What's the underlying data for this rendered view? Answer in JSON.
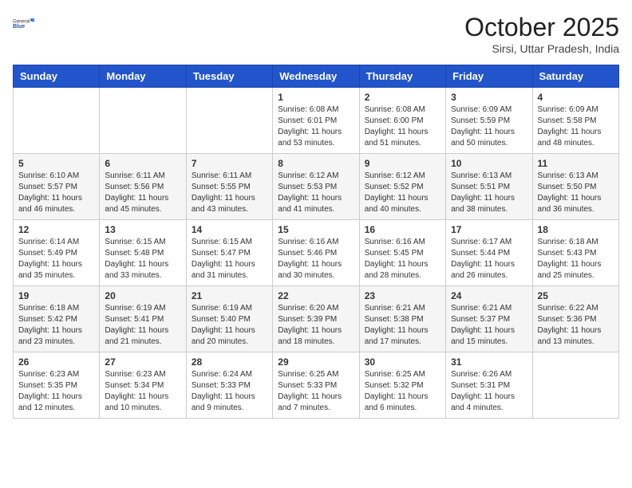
{
  "header": {
    "logo_general": "General",
    "logo_blue": "Blue",
    "month_title": "October 2025",
    "subtitle": "Sirsi, Uttar Pradesh, India"
  },
  "weekdays": [
    "Sunday",
    "Monday",
    "Tuesday",
    "Wednesday",
    "Thursday",
    "Friday",
    "Saturday"
  ],
  "weeks": [
    [
      {
        "day": "",
        "sunrise": "",
        "sunset": "",
        "daylight": ""
      },
      {
        "day": "",
        "sunrise": "",
        "sunset": "",
        "daylight": ""
      },
      {
        "day": "",
        "sunrise": "",
        "sunset": "",
        "daylight": ""
      },
      {
        "day": "1",
        "sunrise": "Sunrise: 6:08 AM",
        "sunset": "Sunset: 6:01 PM",
        "daylight": "Daylight: 11 hours and 53 minutes."
      },
      {
        "day": "2",
        "sunrise": "Sunrise: 6:08 AM",
        "sunset": "Sunset: 6:00 PM",
        "daylight": "Daylight: 11 hours and 51 minutes."
      },
      {
        "day": "3",
        "sunrise": "Sunrise: 6:09 AM",
        "sunset": "Sunset: 5:59 PM",
        "daylight": "Daylight: 11 hours and 50 minutes."
      },
      {
        "day": "4",
        "sunrise": "Sunrise: 6:09 AM",
        "sunset": "Sunset: 5:58 PM",
        "daylight": "Daylight: 11 hours and 48 minutes."
      }
    ],
    [
      {
        "day": "5",
        "sunrise": "Sunrise: 6:10 AM",
        "sunset": "Sunset: 5:57 PM",
        "daylight": "Daylight: 11 hours and 46 minutes."
      },
      {
        "day": "6",
        "sunrise": "Sunrise: 6:11 AM",
        "sunset": "Sunset: 5:56 PM",
        "daylight": "Daylight: 11 hours and 45 minutes."
      },
      {
        "day": "7",
        "sunrise": "Sunrise: 6:11 AM",
        "sunset": "Sunset: 5:55 PM",
        "daylight": "Daylight: 11 hours and 43 minutes."
      },
      {
        "day": "8",
        "sunrise": "Sunrise: 6:12 AM",
        "sunset": "Sunset: 5:53 PM",
        "daylight": "Daylight: 11 hours and 41 minutes."
      },
      {
        "day": "9",
        "sunrise": "Sunrise: 6:12 AM",
        "sunset": "Sunset: 5:52 PM",
        "daylight": "Daylight: 11 hours and 40 minutes."
      },
      {
        "day": "10",
        "sunrise": "Sunrise: 6:13 AM",
        "sunset": "Sunset: 5:51 PM",
        "daylight": "Daylight: 11 hours and 38 minutes."
      },
      {
        "day": "11",
        "sunrise": "Sunrise: 6:13 AM",
        "sunset": "Sunset: 5:50 PM",
        "daylight": "Daylight: 11 hours and 36 minutes."
      }
    ],
    [
      {
        "day": "12",
        "sunrise": "Sunrise: 6:14 AM",
        "sunset": "Sunset: 5:49 PM",
        "daylight": "Daylight: 11 hours and 35 minutes."
      },
      {
        "day": "13",
        "sunrise": "Sunrise: 6:15 AM",
        "sunset": "Sunset: 5:48 PM",
        "daylight": "Daylight: 11 hours and 33 minutes."
      },
      {
        "day": "14",
        "sunrise": "Sunrise: 6:15 AM",
        "sunset": "Sunset: 5:47 PM",
        "daylight": "Daylight: 11 hours and 31 minutes."
      },
      {
        "day": "15",
        "sunrise": "Sunrise: 6:16 AM",
        "sunset": "Sunset: 5:46 PM",
        "daylight": "Daylight: 11 hours and 30 minutes."
      },
      {
        "day": "16",
        "sunrise": "Sunrise: 6:16 AM",
        "sunset": "Sunset: 5:45 PM",
        "daylight": "Daylight: 11 hours and 28 minutes."
      },
      {
        "day": "17",
        "sunrise": "Sunrise: 6:17 AM",
        "sunset": "Sunset: 5:44 PM",
        "daylight": "Daylight: 11 hours and 26 minutes."
      },
      {
        "day": "18",
        "sunrise": "Sunrise: 6:18 AM",
        "sunset": "Sunset: 5:43 PM",
        "daylight": "Daylight: 11 hours and 25 minutes."
      }
    ],
    [
      {
        "day": "19",
        "sunrise": "Sunrise: 6:18 AM",
        "sunset": "Sunset: 5:42 PM",
        "daylight": "Daylight: 11 hours and 23 minutes."
      },
      {
        "day": "20",
        "sunrise": "Sunrise: 6:19 AM",
        "sunset": "Sunset: 5:41 PM",
        "daylight": "Daylight: 11 hours and 21 minutes."
      },
      {
        "day": "21",
        "sunrise": "Sunrise: 6:19 AM",
        "sunset": "Sunset: 5:40 PM",
        "daylight": "Daylight: 11 hours and 20 minutes."
      },
      {
        "day": "22",
        "sunrise": "Sunrise: 6:20 AM",
        "sunset": "Sunset: 5:39 PM",
        "daylight": "Daylight: 11 hours and 18 minutes."
      },
      {
        "day": "23",
        "sunrise": "Sunrise: 6:21 AM",
        "sunset": "Sunset: 5:38 PM",
        "daylight": "Daylight: 11 hours and 17 minutes."
      },
      {
        "day": "24",
        "sunrise": "Sunrise: 6:21 AM",
        "sunset": "Sunset: 5:37 PM",
        "daylight": "Daylight: 11 hours and 15 minutes."
      },
      {
        "day": "25",
        "sunrise": "Sunrise: 6:22 AM",
        "sunset": "Sunset: 5:36 PM",
        "daylight": "Daylight: 11 hours and 13 minutes."
      }
    ],
    [
      {
        "day": "26",
        "sunrise": "Sunrise: 6:23 AM",
        "sunset": "Sunset: 5:35 PM",
        "daylight": "Daylight: 11 hours and 12 minutes."
      },
      {
        "day": "27",
        "sunrise": "Sunrise: 6:23 AM",
        "sunset": "Sunset: 5:34 PM",
        "daylight": "Daylight: 11 hours and 10 minutes."
      },
      {
        "day": "28",
        "sunrise": "Sunrise: 6:24 AM",
        "sunset": "Sunset: 5:33 PM",
        "daylight": "Daylight: 11 hours and 9 minutes."
      },
      {
        "day": "29",
        "sunrise": "Sunrise: 6:25 AM",
        "sunset": "Sunset: 5:33 PM",
        "daylight": "Daylight: 11 hours and 7 minutes."
      },
      {
        "day": "30",
        "sunrise": "Sunrise: 6:25 AM",
        "sunset": "Sunset: 5:32 PM",
        "daylight": "Daylight: 11 hours and 6 minutes."
      },
      {
        "day": "31",
        "sunrise": "Sunrise: 6:26 AM",
        "sunset": "Sunset: 5:31 PM",
        "daylight": "Daylight: 11 hours and 4 minutes."
      },
      {
        "day": "",
        "sunrise": "",
        "sunset": "",
        "daylight": ""
      }
    ]
  ]
}
